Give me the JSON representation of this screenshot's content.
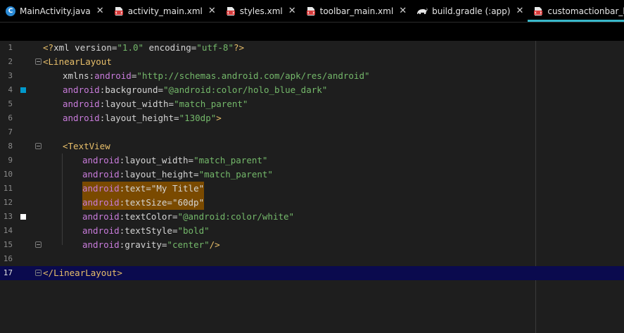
{
  "tabs": [
    {
      "label": "MainActivity.java",
      "icon": "java-class-icon",
      "active": false
    },
    {
      "label": "activity_main.xml",
      "icon": "xml-file-icon",
      "active": false
    },
    {
      "label": "styles.xml",
      "icon": "xml-file-icon",
      "active": false
    },
    {
      "label": "toolbar_main.xml",
      "icon": "xml-file-icon",
      "active": false
    },
    {
      "label": "build.gradle (:app)",
      "icon": "gradle-icon",
      "active": false
    },
    {
      "label": "customactionbar_header.xml",
      "icon": "xml-file-icon",
      "active": true
    }
  ],
  "close_glyph": "✕",
  "java_icon_letter": "C",
  "colors": {
    "accent_tab_underline": "#38b7c9",
    "editor_background": "#1e1e1e",
    "current_line": "#0a0a4e",
    "selection_highlight": "#7a4a00",
    "swatch_holo_blue_dark": "#0099cc",
    "swatch_white": "#ffffff",
    "tag_color": "#e8bf6a",
    "namespace_color": "#c97cdc",
    "string_color": "#74b86a"
  },
  "editor": {
    "current_line": 17,
    "line_numbers": [
      "1",
      "2",
      "3",
      "4",
      "5",
      "6",
      "7",
      "8",
      "9",
      "10",
      "11",
      "12",
      "13",
      "14",
      "15",
      "16",
      "17"
    ],
    "lines": {
      "l1": {
        "a": "<?",
        "b": "xml version",
        "c": "=",
        "d": "\"1.0\"",
        "e": " encoding",
        "f": "=",
        "g": "\"utf-8\"",
        "h": "?>"
      },
      "l2": {
        "a": "<",
        "b": "LinearLayout"
      },
      "l3": {
        "a": "xmlns:",
        "b": "android",
        "c": "=",
        "d": "\"http://schemas.android.com/apk/res/android\""
      },
      "l4": {
        "a": "android",
        "b": ":background",
        "c": "=",
        "d": "\"@android:color/holo_blue_dark\""
      },
      "l5": {
        "a": "android",
        "b": ":layout_width",
        "c": "=",
        "d": "\"match_parent\""
      },
      "l6": {
        "a": "android",
        "b": ":layout_height",
        "c": "=",
        "d": "\"130dp\"",
        "e": ">"
      },
      "l8": {
        "a": "<",
        "b": "TextView"
      },
      "l9": {
        "a": "android",
        "b": ":layout_width",
        "c": "=",
        "d": "\"match_parent\""
      },
      "l10": {
        "a": "android",
        "b": ":layout_height",
        "c": "=",
        "d": "\"match_parent\""
      },
      "l11": {
        "a": "android",
        "b": ":text",
        "c": "=",
        "d": "\"My Title\""
      },
      "l12": {
        "a": "android",
        "b": ":textSize",
        "c": "=",
        "d": "\"60dp\""
      },
      "l13": {
        "a": "android",
        "b": ":textColor",
        "c": "=",
        "d": "\"@android:color/white\""
      },
      "l14": {
        "a": "android",
        "b": ":textStyle",
        "c": "=",
        "d": "\"bold\""
      },
      "l15": {
        "a": "android",
        "b": ":gravity",
        "c": "=",
        "d": "\"center\"",
        "e": "/>"
      },
      "l17": {
        "a": "</",
        "b": "LinearLayout",
        "c": ">"
      }
    }
  }
}
